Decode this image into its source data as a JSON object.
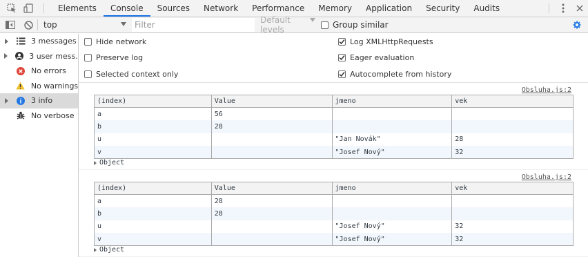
{
  "tabs": [
    {
      "label": "Elements",
      "active": false
    },
    {
      "label": "Console",
      "active": true
    },
    {
      "label": "Sources",
      "active": false
    },
    {
      "label": "Network",
      "active": false
    },
    {
      "label": "Performance",
      "active": false
    },
    {
      "label": "Memory",
      "active": false
    },
    {
      "label": "Application",
      "active": false
    },
    {
      "label": "Security",
      "active": false
    },
    {
      "label": "Audits",
      "active": false
    }
  ],
  "toolbar": {
    "context": "top",
    "filter_placeholder": "Filter",
    "levels": "Default levels",
    "group_similar": "Group similar"
  },
  "sidebar": [
    {
      "label": "3 messages",
      "icon": "list-icon"
    },
    {
      "label": "3 user mess...",
      "icon": "user-icon"
    },
    {
      "label": "No errors",
      "icon": "error-icon"
    },
    {
      "label": "No warnings",
      "icon": "warning-icon"
    },
    {
      "label": "3 info",
      "icon": "info-icon",
      "selected": true
    },
    {
      "label": "No verbose",
      "icon": "bug-icon"
    }
  ],
  "settings": {
    "left": [
      {
        "label": "Hide network",
        "checked": false
      },
      {
        "label": "Preserve log",
        "checked": false
      },
      {
        "label": "Selected context only",
        "checked": false
      }
    ],
    "right": [
      {
        "label": "Log XMLHttpRequests",
        "checked": true
      },
      {
        "label": "Eager evaluation",
        "checked": true
      },
      {
        "label": "Autocomplete from history",
        "checked": true
      }
    ]
  },
  "messages": [
    {
      "source": "Obsluha.js:2",
      "headers": [
        "(index)",
        "Value",
        "jmeno",
        "vek"
      ],
      "rows": [
        [
          "a",
          "56",
          "",
          ""
        ],
        [
          "b",
          "28",
          "",
          ""
        ],
        [
          "u",
          "",
          "\"Jan Novák\"",
          "28"
        ],
        [
          "v",
          "",
          "\"Josef Nový\"",
          "32"
        ]
      ],
      "footer": "Object"
    },
    {
      "source": "Obsluha.js:2",
      "headers": [
        "(index)",
        "Value",
        "jmeno",
        "vek"
      ],
      "rows": [
        [
          "a",
          "28",
          "",
          ""
        ],
        [
          "b",
          "28",
          "",
          ""
        ],
        [
          "u",
          "",
          "\"Josef Nový\"",
          "32"
        ],
        [
          "v",
          "",
          "\"Josef Nový\"",
          "32"
        ]
      ],
      "footer": "Object"
    }
  ],
  "colors": {
    "accent": "#1a73e8",
    "number": "#1c00cf",
    "string": "#c41a16",
    "selected_row": "#dadada"
  }
}
